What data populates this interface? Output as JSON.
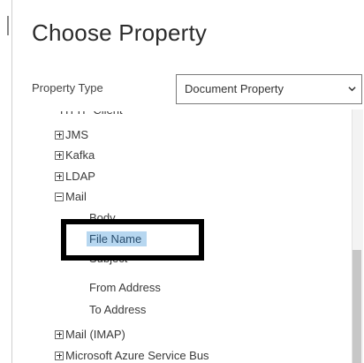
{
  "dialog": {
    "title": "Choose Property",
    "property_type_label": "Property Type",
    "property_type_value": "Document Property"
  },
  "tree": {
    "partial_top": "HTTP Client",
    "items": {
      "jms": "JMS",
      "kafka": "Kafka",
      "ldap": "LDAP",
      "mail": "Mail",
      "mail_imap": "Mail (IMAP)",
      "azure_service_bus": "Microsoft Azure Service Bus"
    },
    "mail_children": {
      "body": "Body",
      "file_name": "File Name",
      "subject": "Subject",
      "from_address": "From Address",
      "to_address": "To Address"
    },
    "selected": "File Name"
  },
  "colors": {
    "selection": "#b7d7f0",
    "highlight_border": "#000000"
  },
  "icons": {
    "expand": "plus-box-icon",
    "collapse": "minus-box-icon",
    "dropdown": "chevron-down-icon"
  }
}
